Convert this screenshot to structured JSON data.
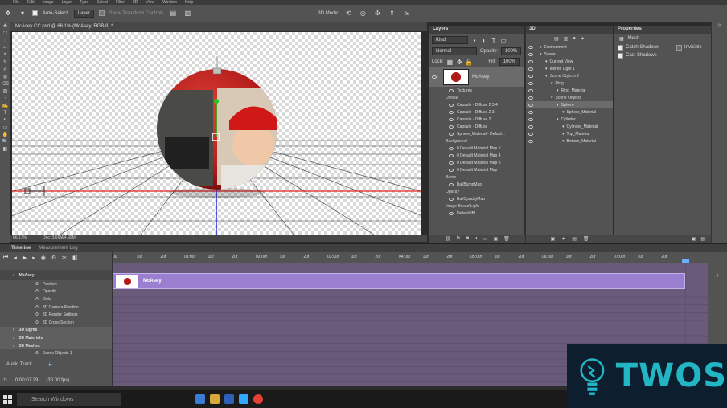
{
  "menubar": {
    "items": [
      "File",
      "Edit",
      "Image",
      "Layer",
      "Type",
      "Select",
      "Filter",
      "3D",
      "View",
      "Window",
      "Help"
    ]
  },
  "optionsbar": {
    "auto_select_label": "Auto-Select:",
    "auto_select_value": "Layer",
    "show_transform_label": "Show Transform Controls",
    "mode_label": "3D Mode:"
  },
  "document": {
    "tab_title": "McAsey CC.psd @ 66.1% (McAsey, RGB/8) *",
    "zoom": "66.17%",
    "doc_info": "Doc: 3.66M/4.99M"
  },
  "layers_panel": {
    "title": "Layers",
    "filter_kind": "Kind",
    "blend_mode": "Normal",
    "opacity_label": "Opacity:",
    "opacity_value": "100%",
    "lock_label": "Lock:",
    "fill_label": "Fill:",
    "fill_value": "100%",
    "layer_name": "McAsey",
    "rows": [
      {
        "text": "Textures",
        "style": "normal",
        "eye": true
      },
      {
        "text": "Diffuse",
        "style": "italic",
        "eye": false
      },
      {
        "text": "Capsule - Diffuse 2 3 4",
        "style": "normal",
        "eye": true
      },
      {
        "text": "Capsule - Diffuse 2 3",
        "style": "normal",
        "eye": true
      },
      {
        "text": "Capsule - Diffuse 2",
        "style": "normal",
        "eye": true
      },
      {
        "text": "Capsule - Diffuse",
        "style": "normal",
        "eye": true
      },
      {
        "text": "Sphere_Material - Defaul...",
        "style": "normal",
        "eye": true
      },
      {
        "text": "Background",
        "style": "italic",
        "eye": false
      },
      {
        "text": "0 Default Material Map 5",
        "style": "normal",
        "eye": true
      },
      {
        "text": "0 Default Material Map 4",
        "style": "normal",
        "eye": true
      },
      {
        "text": "0 Default Material Map 3",
        "style": "normal",
        "eye": true
      },
      {
        "text": "0 Default Material Map",
        "style": "normal",
        "eye": true
      },
      {
        "text": "Bump",
        "style": "italic",
        "eye": false
      },
      {
        "text": "BallBumpMap",
        "style": "normal",
        "eye": true
      },
      {
        "text": "Opacity",
        "style": "italic",
        "eye": false
      },
      {
        "text": "BallOpacityMap",
        "style": "normal",
        "eye": true
      },
      {
        "text": "Image Based Light",
        "style": "italic",
        "eye": false
      },
      {
        "text": "Default IBL",
        "style": "normal",
        "eye": true
      }
    ]
  },
  "scene3d_panel": {
    "title": "3D",
    "rows": [
      {
        "text": "Environment",
        "indent": 0,
        "style": "normal"
      },
      {
        "text": "Scene",
        "indent": 0,
        "style": "normal"
      },
      {
        "text": "Current View",
        "indent": 1,
        "style": "normal"
      },
      {
        "text": "Infinite Light 1",
        "indent": 1,
        "style": "normal"
      },
      {
        "text": "Scene Objects 1",
        "indent": 1,
        "style": "italic"
      },
      {
        "text": "Ring",
        "indent": 2,
        "style": "normal"
      },
      {
        "text": "Ring_Material",
        "indent": 3,
        "style": "normal"
      },
      {
        "text": "Scene Objects",
        "indent": 2,
        "style": "normal"
      },
      {
        "text": "Sphere",
        "indent": 3,
        "style": "selected"
      },
      {
        "text": "Sphere_Material",
        "indent": 4,
        "style": "normal"
      },
      {
        "text": "Cylinder",
        "indent": 3,
        "style": "normal"
      },
      {
        "text": "Cylinder_Material",
        "indent": 4,
        "style": "normal"
      },
      {
        "text": "Top_Material",
        "indent": 4,
        "style": "normal"
      },
      {
        "text": "Bottom_Material",
        "indent": 4,
        "style": "normal"
      }
    ]
  },
  "properties_panel": {
    "title": "Properties",
    "type_label": "Mesh",
    "catch_shadows": "Catch Shadows",
    "invisible": "Invisible",
    "cast_shadows": "Cast Shadows"
  },
  "timeline": {
    "tab_timeline": "Timeline",
    "tab_log": "Measurement Log",
    "ruler": [
      "00",
      "10f",
      "20f",
      "01:00f",
      "10f",
      "20f",
      "02:00f",
      "10f",
      "20f",
      "03:00f",
      "10f",
      "20f",
      "04:00f",
      "10f",
      "20f",
      "05:00f",
      "10f",
      "20f",
      "06:00f",
      "10f",
      "20f",
      "07:00f",
      "10f",
      "20f"
    ],
    "clip_name": "McAsey",
    "time": "0:00:07:29",
    "fps": "(30.00 fps)",
    "audio_track": "Audio Track",
    "rows": [
      {
        "text": "McAsey",
        "kind": "layer",
        "indent": 0
      },
      {
        "text": "Position",
        "kind": "prop",
        "indent": 1
      },
      {
        "text": "Opacity",
        "kind": "prop",
        "indent": 1
      },
      {
        "text": "Style",
        "kind": "prop",
        "indent": 1
      },
      {
        "text": "3D Camera Position",
        "kind": "prop",
        "indent": 1
      },
      {
        "text": "3D Render Settings",
        "kind": "prop",
        "indent": 1
      },
      {
        "text": "3D Cross Section",
        "kind": "prop",
        "indent": 1
      },
      {
        "text": "3D Lights",
        "kind": "group",
        "indent": 0
      },
      {
        "text": "3D Materials",
        "kind": "group",
        "indent": 0
      },
      {
        "text": "3D Meshes",
        "kind": "group",
        "indent": 0
      },
      {
        "text": "Scene Objects 1",
        "kind": "prop",
        "indent": 1
      }
    ]
  },
  "taskbar": {
    "search_placeholder": "Search Windows"
  },
  "watermark": {
    "text": "TWOS"
  },
  "colors": {
    "panel_bg": "#535353",
    "clip_purple": "#9a7fd0",
    "track_purple": "#6a5a7a",
    "ornament_red": "#c8201e",
    "brand_teal": "#22b6c5"
  }
}
